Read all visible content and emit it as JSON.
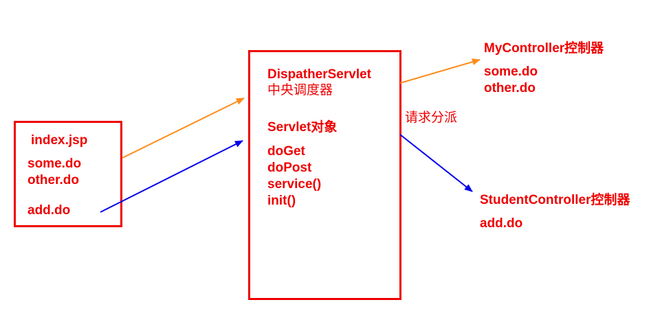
{
  "index_box": {
    "title": "index.jsp",
    "line1": "some.do",
    "line2": "other.do",
    "line3": "add.do"
  },
  "dispatcher_box": {
    "name": "DispatherServlet",
    "subtitle": "中央调度器",
    "servlet_label": "Servlet对象",
    "methods": [
      "doGet",
      "doPost",
      "service()",
      "init()"
    ]
  },
  "dispatch_label": "请求分派",
  "my_controller": {
    "title": "MyController控制器",
    "line1": "some.do",
    "line2": "other.do"
  },
  "student_controller": {
    "title": "StudentController控制器",
    "line1": "add.do"
  },
  "colors": {
    "text": "#ee0000",
    "orange_arrow": "#ff8c1a",
    "blue_arrow": "#0000ee"
  }
}
